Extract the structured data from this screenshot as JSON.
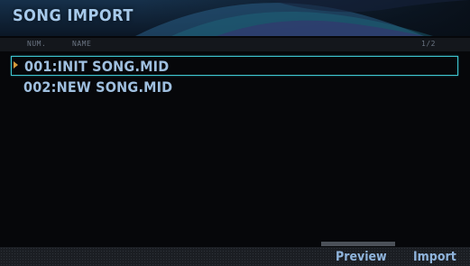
{
  "header": {
    "title": "SONG IMPORT"
  },
  "columns": {
    "num_label": "NUM.",
    "name_label": "NAME",
    "page_indicator": "1/2"
  },
  "songs": [
    {
      "label": "001:INIT SONG.MID",
      "selected": true
    },
    {
      "label": "002:NEW SONG.MID",
      "selected": false
    }
  ],
  "footer": {
    "preview_label": "Preview",
    "import_label": "Import"
  },
  "colors": {
    "accent_cyan": "#3fc7d3",
    "cursor_orange": "#d79a3a",
    "text_blue": "#9fbfdf"
  }
}
